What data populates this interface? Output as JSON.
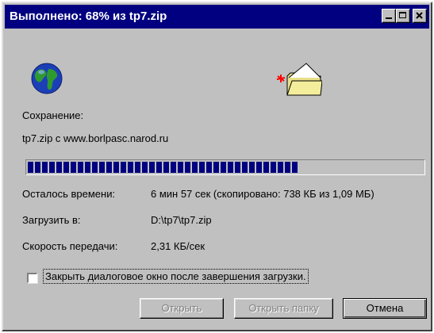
{
  "window": {
    "title": "Выполнено: 68% из tp7.zip",
    "title_bg": "#000080",
    "face_color": "#c0c0c0"
  },
  "title_buttons": {
    "minimize": "minimize-icon",
    "maximize": "maximize-icon",
    "close": "close-icon"
  },
  "icons": {
    "source": "globe-icon",
    "destination": "folder-icon"
  },
  "saving": {
    "label": "Сохранение:",
    "source": "tp7.zip с www.borlpasc.narod.ru"
  },
  "progress": {
    "percent": 68,
    "fill_color": "#000080"
  },
  "details": {
    "time_left_label": "Осталось времени:",
    "time_left_value": "6 мин 57 сек (скопировано: 738 КБ из 1,09 МБ)",
    "download_to_label": "Загрузить в:",
    "download_to_value": "D:\\tp7\\tp7.zip",
    "speed_label": "Скорость передачи:",
    "speed_value": "2,31 КБ/сек"
  },
  "checkbox": {
    "label": "Закрыть диалоговое окно после завершения загрузки.",
    "checked": false
  },
  "buttons": {
    "open": "Открыть",
    "open_folder": "Открыть папку",
    "cancel": "Отмена"
  }
}
